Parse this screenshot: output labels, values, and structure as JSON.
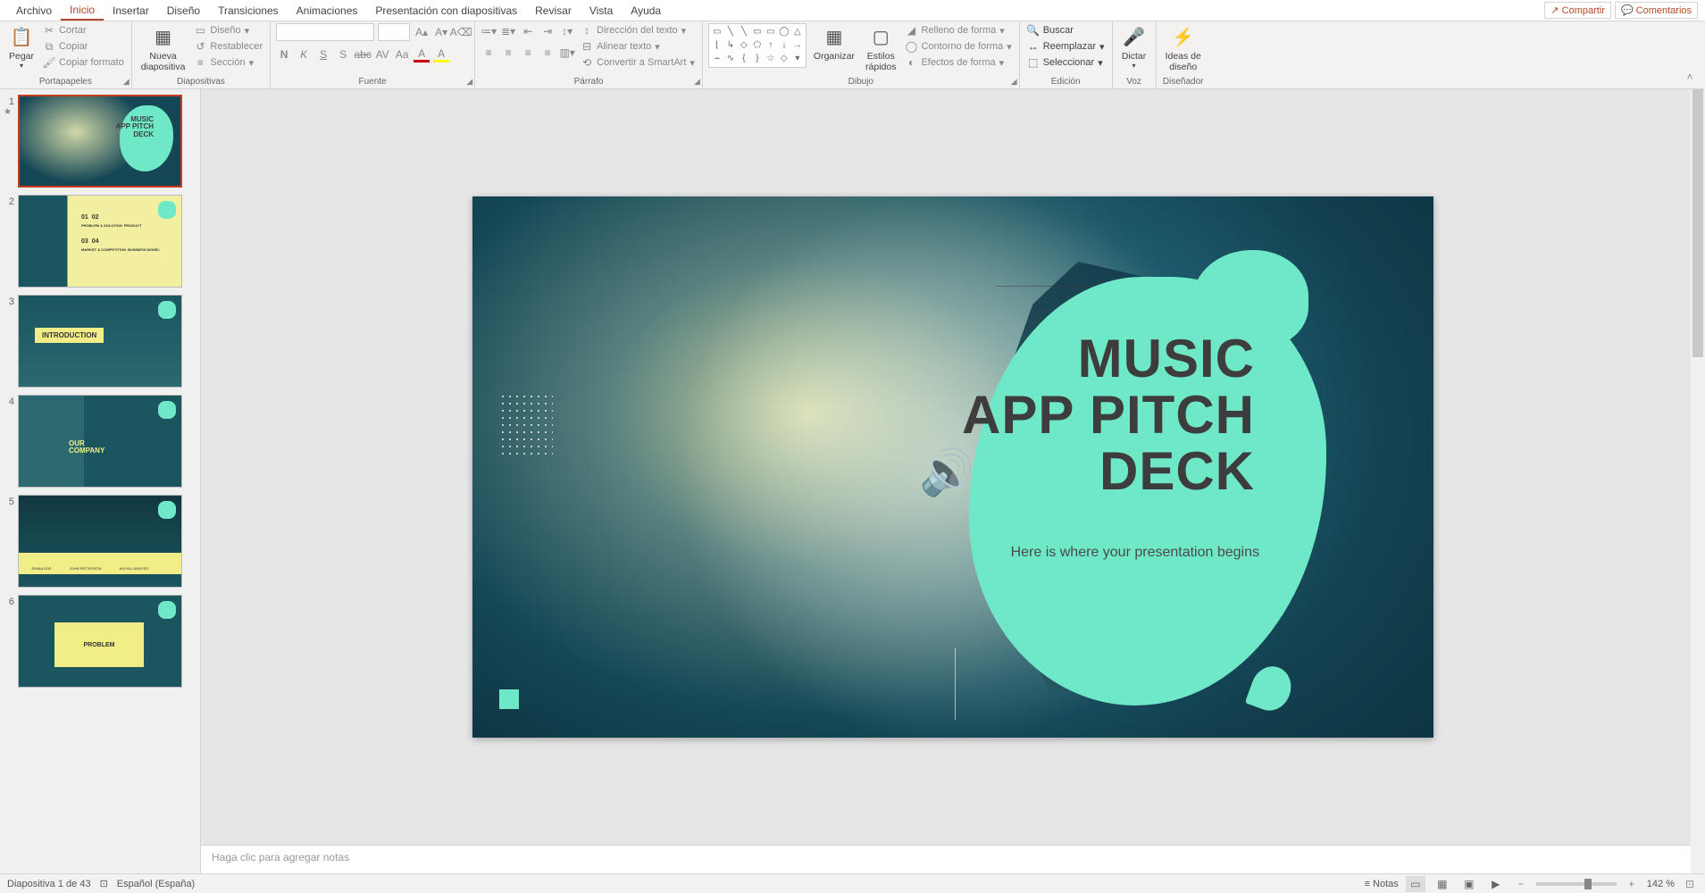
{
  "tabs": {
    "archivo": "Archivo",
    "inicio": "Inicio",
    "insertar": "Insertar",
    "diseno": "Diseño",
    "transiciones": "Transiciones",
    "animaciones": "Animaciones",
    "presentacion": "Presentación con diapositivas",
    "revisar": "Revisar",
    "vista": "Vista",
    "ayuda": "Ayuda"
  },
  "top_right": {
    "compartir": "Compartir",
    "comentarios": "Comentarios"
  },
  "ribbon": {
    "portapapeles": {
      "label": "Portapapeles",
      "pegar": "Pegar",
      "cortar": "Cortar",
      "copiar": "Copiar",
      "copiar_formato": "Copiar formato"
    },
    "diapositivas": {
      "label": "Diapositivas",
      "nueva": "Nueva\ndiapositiva",
      "diseno": "Diseño",
      "restablecer": "Restablecer",
      "seccion": "Sección"
    },
    "fuente": {
      "label": "Fuente"
    },
    "parrafo": {
      "label": "Párrafo",
      "dir_texto": "Dirección del texto",
      "alinear": "Alinear texto",
      "smartart": "Convertir a SmartArt"
    },
    "dibujo": {
      "label": "Dibujo",
      "organizar": "Organizar",
      "estilos": "Estilos\nrápidos",
      "relleno": "Relleno de forma",
      "contorno": "Contorno de forma",
      "efectos": "Efectos de forma"
    },
    "edicion": {
      "label": "Edición",
      "buscar": "Buscar",
      "reemplazar": "Reemplazar",
      "seleccionar": "Seleccionar"
    },
    "voz": {
      "label": "Voz",
      "dictar": "Dictar"
    },
    "disenador": {
      "label": "Diseñador",
      "ideas": "Ideas de\ndiseño"
    }
  },
  "font_buttons": [
    "N",
    "K",
    "S",
    "S",
    "abc",
    "AV",
    "Aa"
  ],
  "slide": {
    "title_l1": "MUSIC",
    "title_l2": "APP PITCH",
    "title_l3": "DECK",
    "subtitle": "Here is where your presentation begins"
  },
  "thumbs": {
    "t1": {
      "l1": "MUSIC",
      "l2": "APP PITCH",
      "l3": "DECK"
    },
    "t2": {
      "n1": "01",
      "n2": "02",
      "n3": "03",
      "n4": "04",
      "lab1": "PROBLEM & SOLUTION",
      "lab2": "PRODUCT",
      "lab3": "MARKET & COMPETITION",
      "lab4": "BUSINESS MODEL"
    },
    "t3": "INTRODUCTION",
    "t4": {
      "l1": "OUR",
      "l2": "COMPANY"
    },
    "t5": {
      "n1": "JENNA DOE",
      "n2": "JOHN PATTERSON",
      "n3": "ALEXA LAWLESS"
    },
    "t6": "PROBLEM"
  },
  "notes_placeholder": "Haga clic para agregar notas",
  "status": {
    "slide_of": "Diapositiva 1 de 43",
    "lang": "Español (España)",
    "notas": "Notas",
    "zoom": "142 %"
  }
}
